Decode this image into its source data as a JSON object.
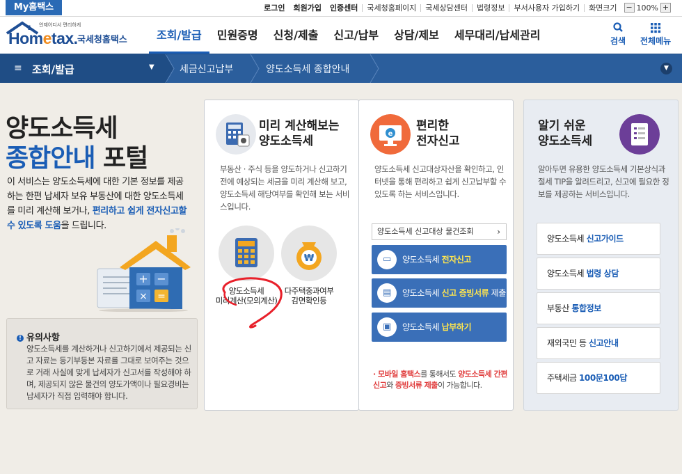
{
  "topbar": {
    "my_tab": "My홈택스",
    "links": [
      "로그인",
      "회원가입",
      "인증센터",
      "국세청홈페이지",
      "국세상담센터",
      "법령정보",
      "부서사용자 가입하기",
      "화면크기"
    ],
    "zoom_out": "−",
    "zoom_value": "100%",
    "zoom_in": "+"
  },
  "header": {
    "logo_small": "언제어디서 편리하게",
    "logo_home": "Hom",
    "logo_e": "e",
    "logo_tax": "tax.",
    "logo_kr": "국세청홈택스",
    "nav": [
      "조회/발급",
      "민원증명",
      "신청/제출",
      "신고/납부",
      "상담/제보",
      "세무대리/납세관리"
    ],
    "search_label": "검색",
    "menu_label": "전체메뉴"
  },
  "breadcrumb": {
    "menu_icon": "≡",
    "current": "조회/발급",
    "level2": "세금신고납부",
    "level3": "양도소득세 종합안내"
  },
  "intro": {
    "title_line1": "양도소득세",
    "title_blue": "종합안내",
    "title_rest": " 포털",
    "text_plain": "이 서비스는 양도소득세에 대한 기본 정보를 제공하는 한편 납세자 보유 부동산에 대한 양도소득세를 미리 계산해 보거나, ",
    "text_hl": "편리하고 쉽게 전자신고할 수 있도록 도움",
    "text_end": "을 드립니다."
  },
  "notice": {
    "title": "유의사항",
    "body": "양도소득세를 계산하거나 신고하기에서 제공되는 신고 자료는 등기부등본 자료를 그대로 보여주는 것으로 거래 사실에 맞게 납세자가 신고서를 작성해야 하며, 제공되지 않은 물건의 양도가액이나 필요경비는 납세자가 직접 입력해야 합니다."
  },
  "panel1": {
    "title_line1": "미리 계산해보는",
    "title_line2": "양도소득세",
    "desc": "부동산 · 주식 등을 양도하거나 신고하기 전에 예상되는 세금을 미리 계산해 보고, 양도소득세 해당여부를 확인해 보는 서비스입니다.",
    "item1_line1": "양도소득세",
    "item1_line2": "미리계산(모의계산)",
    "item2_line1": "다주택중과여부",
    "item2_line2": "감면확인등"
  },
  "panel2": {
    "title_line1": "편리한",
    "title_line2": "전자신고",
    "desc": "양도소득세 신고대상자산을 확인하고, 인터넷을 통해 편리하고 쉽게 신고납부할 수 있도록 하는 서비스입니다.",
    "select_label": "양도소득세 신고대상 물건조회",
    "btn1_plain": "양도소득세 ",
    "btn1_hl": "전자신고",
    "btn2_plain": "양도소득세 ",
    "btn2_hl": "신고 증빙서류",
    "btn2_end": " 제출",
    "btn3_plain": "양도소득세 ",
    "btn3_hl": "납부하기",
    "note_a": "모바일 홈택스",
    "note_b": "를 통해서도 ",
    "note_c": "양도소득세 간편신고",
    "note_d": "와 ",
    "note_e": "증빙서류 제출",
    "note_f": "이 가능합니다."
  },
  "panel3": {
    "title_line1": "알기 쉬운",
    "title_line2": "양도소득세",
    "desc": "알아두면 유용한 양도소득세 기본상식과 절세 TIP을 알려드리고, 신고에 필요한 정보를 제공하는 서비스입니다.",
    "links": [
      {
        "plain": "양도소득세 ",
        "bold": "신고가이드"
      },
      {
        "plain": "양도소득세 ",
        "bold": "법령 상담"
      },
      {
        "plain": "부동산 ",
        "bold": "통합정보"
      },
      {
        "plain": "재외국민 등 ",
        "bold": "신고안내"
      },
      {
        "plain": "주택세금 ",
        "bold": "100문100답"
      }
    ]
  },
  "colors": {
    "brand_blue": "#1a5db5",
    "bar_blue": "#2b5e9c",
    "button_blue": "#3a6fb8",
    "highlight_yellow": "#ffe64f",
    "annotation_red": "#e8202a"
  }
}
